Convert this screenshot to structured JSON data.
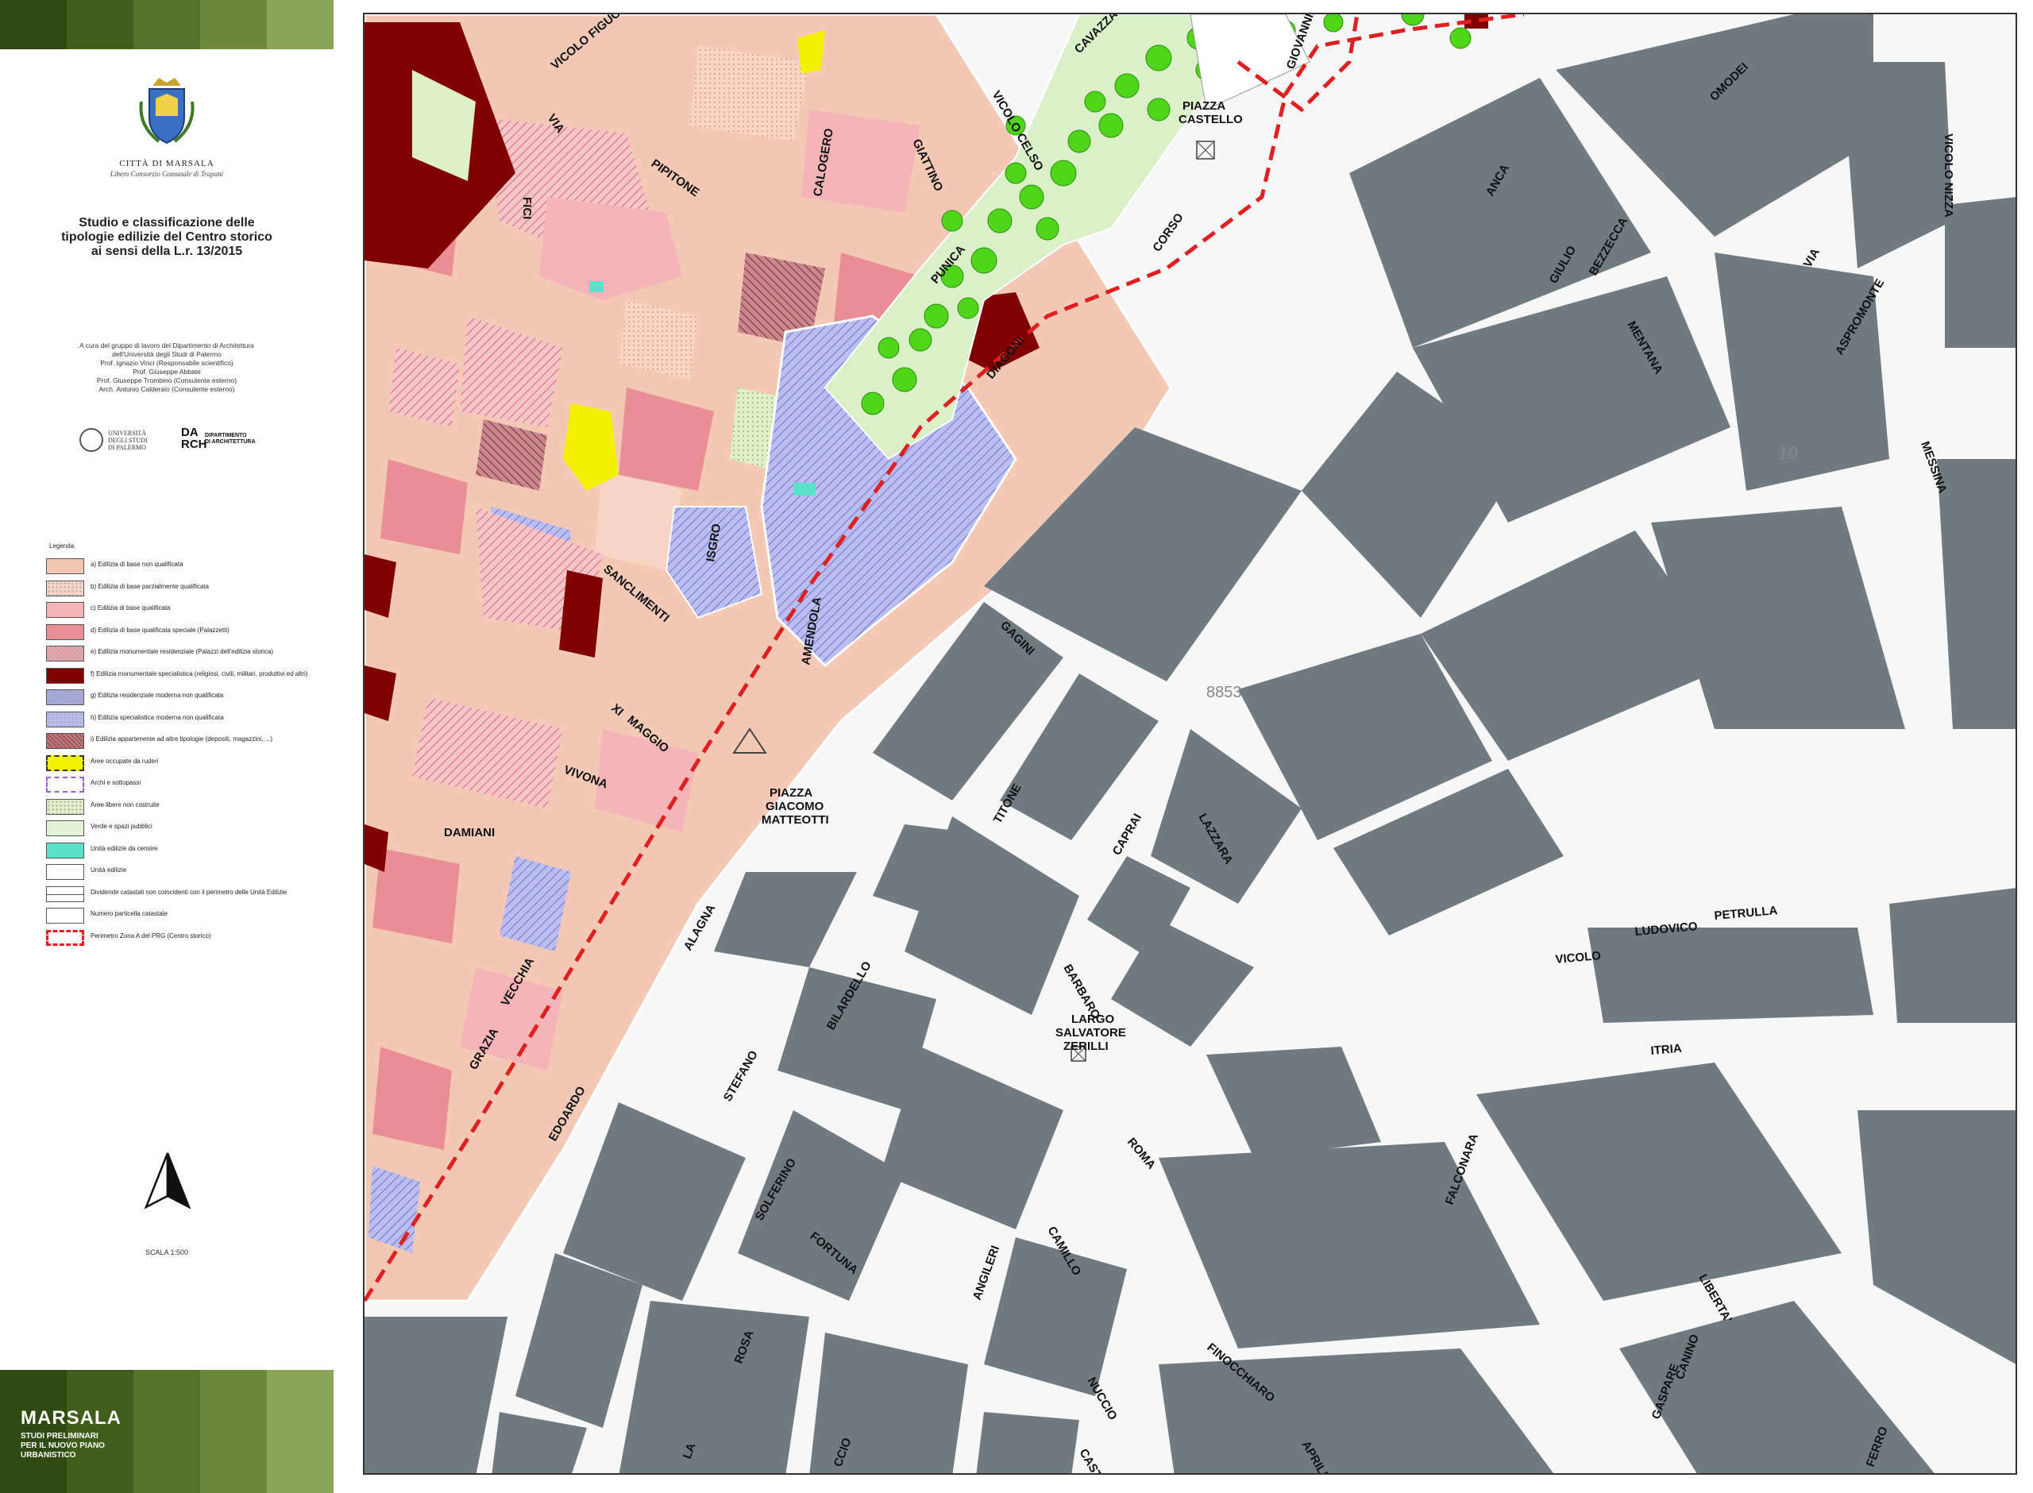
{
  "header": {
    "city_name": "CITTÀ DI MARSALA",
    "city_subtitle": "Libero Consorzio Comunale di Trapani",
    "title": "Studio e classificazione delle\ntipologie edilizie del Centro storico\nai sensi della L.r. 13/2015",
    "credits": "A cura del gruppo di lavoro del Dipartimento di Architettura\ndell'Università degli Studi di Palermo\nProf. Ignazio Vinci (Responsabile scientifico)\nProf. Giuseppe Abbate\nProf. Giuseppe Trombino (Consulente esterno)\nArch. Antonio Calderaio (Consulente esterno)",
    "university_name": "UNIVERSITÀ\nDEGLI STUDI\nDI PALERMO",
    "dept_mark": "DA\nRCH",
    "dept_name": "DIPARTIMENTO\nDI ARCHITETTURA"
  },
  "legend": {
    "title": "Legenda",
    "items": [
      {
        "label": "a) Edilizia di base non qualificata",
        "color": "#f3c9b6",
        "pattern": "solid"
      },
      {
        "label": "b) Edilizia di base parzialmente qualificata",
        "color": "#f7d4c4",
        "pattern": "dots"
      },
      {
        "label": "c) Edilizia di base qualificata",
        "color": "#f4b4b8",
        "pattern": "solid"
      },
      {
        "label": "d) Edilizia di base qualificata speciale (Palazzetti)",
        "color": "#ea8e96",
        "pattern": "solid"
      },
      {
        "label": "e) Edilizia monumentale residenziale (Palazzi dell'edilizia storica)",
        "color": "#f0a4ab",
        "pattern": "hatch"
      },
      {
        "label": "f) Edilizia monumentale specialistica (religiosi, civili, militari, produttivi ed altri)",
        "color": "#800000",
        "pattern": "solid"
      },
      {
        "label": "g) Edilizia residenziale moderna non qualificata",
        "color": "#a3a8e3",
        "pattern": "hatch"
      },
      {
        "label": "h) Edilizia specialistica moderna non qualificata",
        "color": "#b7bdf0",
        "pattern": "dots"
      },
      {
        "label": "i) Edilizia appartenente ad altre tipologie (depositi, magazzini, ...)",
        "color": "#b4555a",
        "pattern": "hatch"
      },
      {
        "label": "Aree occupate da ruderi",
        "color": "#f2f200",
        "pattern": "dashed"
      },
      {
        "label": "Archi e sottopassi",
        "color": "#ffffff",
        "pattern": "purple-dashed"
      },
      {
        "label": "Aree libere non costruite",
        "color": "#dff0c8",
        "pattern": "dots"
      },
      {
        "label": "Verde e spazi pubblici",
        "color": "#e2f3d4",
        "pattern": "solid"
      },
      {
        "label": "Unità edilizie da censire",
        "color": "#5fe0cc",
        "pattern": "solid"
      },
      {
        "label": "Unità edilizie",
        "color": "#ffffff",
        "pattern": "outline"
      },
      {
        "label": "Dividende catastali non coincidenti con il perimetro delle Unità Edilizie",
        "color": "#ffffff",
        "pattern": "line"
      },
      {
        "label": "Numero particella catastale",
        "color": "#ffffff",
        "pattern": "outline"
      },
      {
        "label": "Perimetro Zona A del PRG (Centro storico)",
        "color": "#ffffff",
        "pattern": "red-dashed"
      }
    ]
  },
  "footer": {
    "scale": "SCALA 1:500",
    "brand": "MARSALA",
    "brand_sub": "STUDI PRELIMINARI\nPER IL NUOVO PIANO\nURBANISTICO",
    "stripe_colors": [
      "#2f4a12",
      "#3f5e1a",
      "#56732b",
      "#6d8a3c",
      "#89a357"
    ]
  },
  "map": {
    "colors": {
      "modern_block": "#6f7b80",
      "perimeter": "#e02020",
      "tree": "#4fd61a",
      "park": "#d9f0c8",
      "monument": "#800000"
    },
    "streets": [
      "VICOLO FIGUCCIA",
      "VIA",
      "FICI",
      "PIPITONE",
      "CALOGERO",
      "GIATTINO",
      "VICOLO CELSO",
      "CAVAZZA",
      "PIAZZA",
      "CASTELLO",
      "GIOVANNI",
      "OMODEI",
      "CORSO",
      "ANCA",
      "GIULIO",
      "BEZZECCA",
      "MENTANA",
      "VIA",
      "ASPROMONTE",
      "VICOLO NIZZA",
      "MESSINA",
      "PUNICA",
      "DIAGONI",
      "SANCLIMENTI",
      "ISGRO",
      "XI",
      "MAGGIO",
      "VIVONA",
      "DAMIANI",
      "AMENDOLA",
      "GAGINI",
      "TITONE",
      "CAPRAI",
      "LAZZARA",
      "PIAZZA",
      "GIACOMO",
      "MATTEOTTI",
      "ALAGNA",
      "GRAZIA",
      "VECCHIA",
      "EDOARDO",
      "BILARDELLO",
      "BARBARO",
      "LARGO",
      "SALVATORE",
      "ZERILLI",
      "STEFANO",
      "SOLFERINO",
      "FORTUNA",
      "ROMA",
      "CAMILLO",
      "ANGILERI",
      "ROSA",
      "NUCCIO",
      "FINOCCHIARO",
      "APRILE",
      "CASTELLO",
      "FALCONARA",
      "ITRIA",
      "VICOLO",
      "LUDOVICO",
      "PETRULLA",
      "GASPARE",
      "CANINO",
      "LIBERTA'",
      "FERRO",
      "LA",
      "CCIO"
    ],
    "numbers": [
      "8853",
      "10"
    ]
  }
}
